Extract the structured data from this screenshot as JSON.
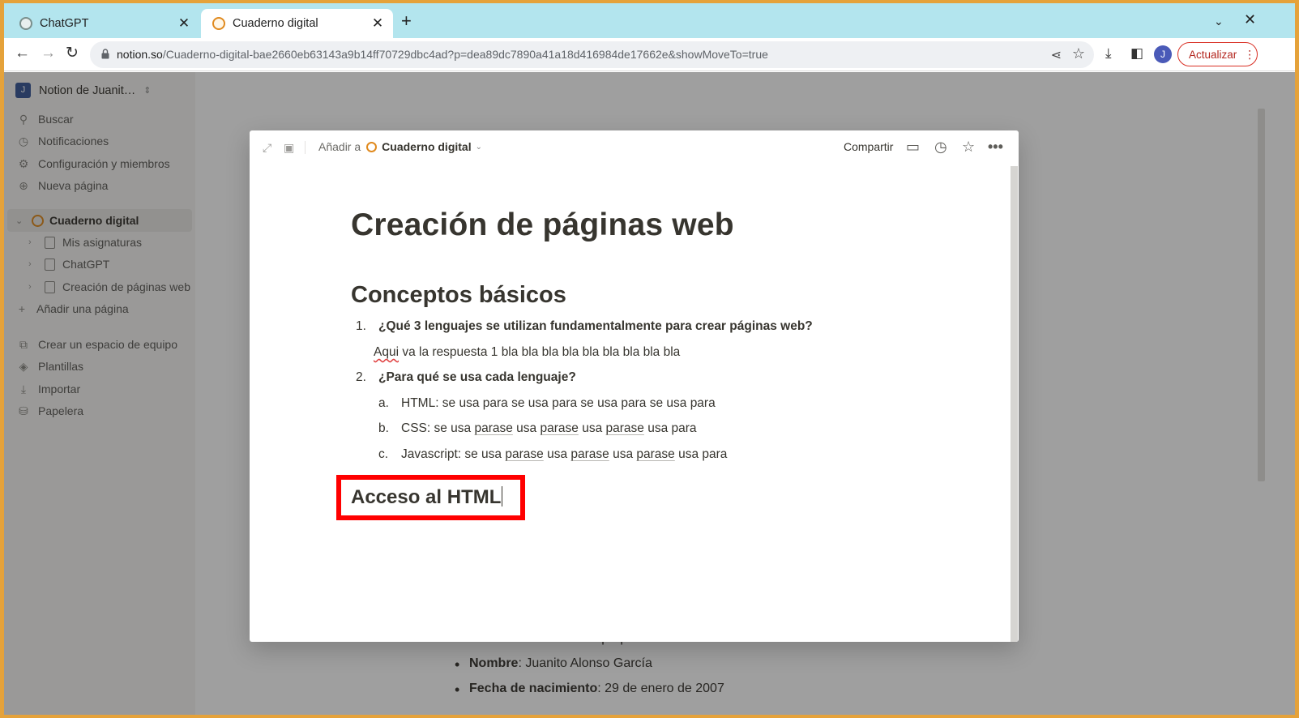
{
  "browser": {
    "tabs": [
      {
        "title": "ChatGPT",
        "icon": "chatgpt-icon",
        "active": false
      },
      {
        "title": "Cuaderno digital",
        "icon": "notion-page-icon",
        "active": true
      }
    ],
    "address": {
      "host": "notion.so",
      "path": "/Cuaderno-digital-bae2660eb63143a9b14ff70729dbc4ad?p=dea89dc7890a41a18d416984de17662e&showMoveTo=true"
    },
    "profile_initial": "J",
    "update_label": "Actualizar"
  },
  "sidebar": {
    "workspace_name": "Notion de Juanit…",
    "workspace_initial": "J",
    "menu": [
      {
        "label": "Buscar",
        "icon": "search-icon"
      },
      {
        "label": "Notificaciones",
        "icon": "clock-icon"
      },
      {
        "label": "Configuración y miembros",
        "icon": "gear-icon"
      },
      {
        "label": "Nueva página",
        "icon": "plus-circle-icon"
      }
    ],
    "tree": {
      "root": "Cuaderno digital",
      "children": [
        "Mis asignaturas",
        "ChatGPT",
        "Creación de páginas web"
      ],
      "add_page": "Añadir una página"
    },
    "bottom": [
      {
        "label": "Crear un espacio de equipo",
        "icon": "team-space-icon"
      },
      {
        "label": "Plantillas",
        "icon": "templates-icon"
      },
      {
        "label": "Importar",
        "icon": "download-icon"
      },
      {
        "label": "Papelera",
        "icon": "trash-icon"
      }
    ]
  },
  "background_page": {
    "intro": "A continuación detallo una pequeña información sobre mí:",
    "items": [
      {
        "key": "Nombre",
        "value": ": Juanito Alonso García"
      },
      {
        "key": "Fecha de nacimiento",
        "value": ": 29 de enero de 2007"
      }
    ]
  },
  "modal": {
    "add_to_label": "Añadir a",
    "add_to_target": "Cuaderno digital",
    "share_label": "Compartir",
    "title": "Creación de páginas web",
    "section1_heading": "Conceptos básicos",
    "q1_num": "1.",
    "q1": "¿Qué 3 lenguajes se utilizan fundamentalmente para crear páginas web?",
    "a1_word": "Aqui",
    "a1_rest": " va la respuesta 1 bla bla bla bla bla bla bla bla bla",
    "q2_num": "2.",
    "q2": "¿Para qué se usa cada lenguaje?",
    "a_label": "a.",
    "a_text": "HTML: se usa para se usa para se usa para se usa para",
    "b_label": "b.",
    "b_parts": [
      "CSS: se usa ",
      "parase",
      " usa ",
      "parase",
      " usa ",
      "parase",
      " usa para"
    ],
    "c_label": "c.",
    "c_parts": [
      "Javascript: se usa ",
      "parase",
      " usa ",
      "parase",
      " usa ",
      "parase",
      " usa para"
    ],
    "section2_heading": "Acceso al HTML"
  },
  "colors": {
    "highlight_border": "#ff0000",
    "tab_bar": "#b3e5ee",
    "update_button": "#d93025"
  }
}
